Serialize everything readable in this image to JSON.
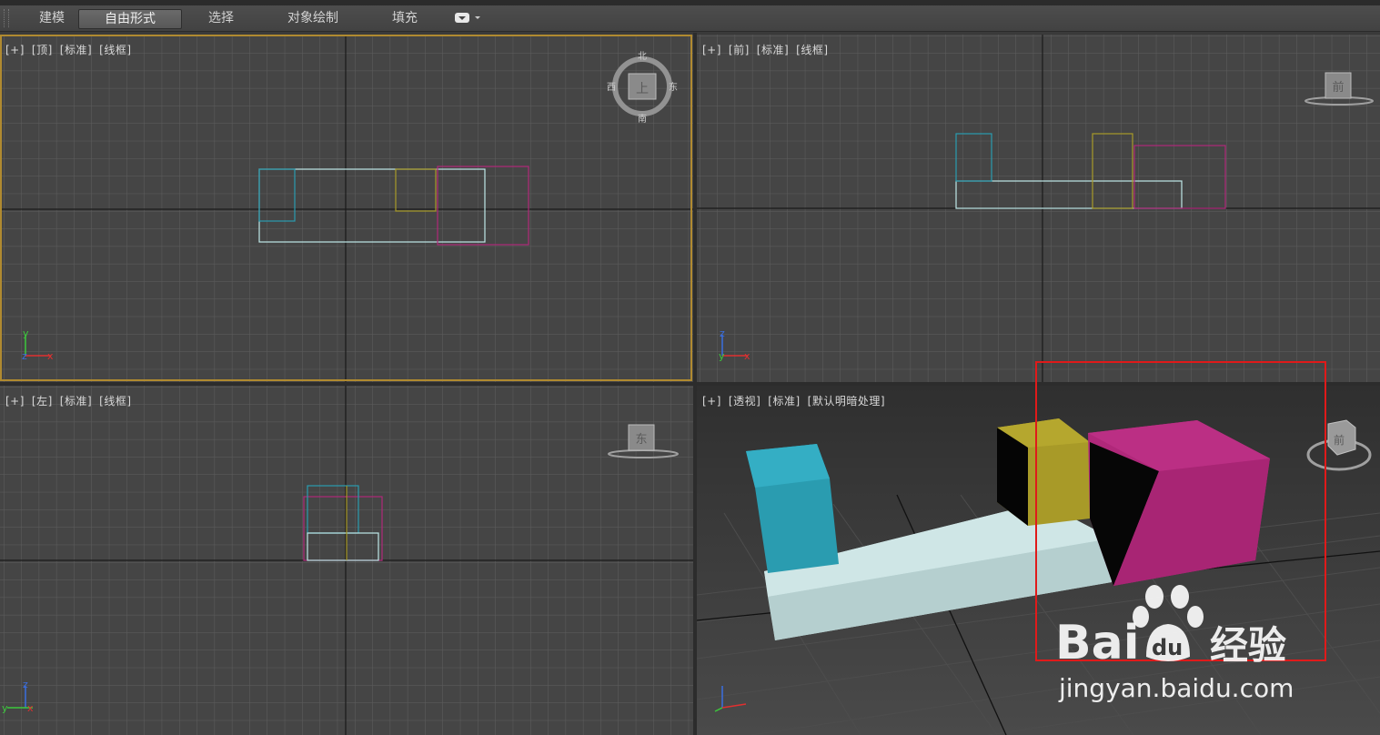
{
  "ribbon": {
    "tabs": [
      "建模",
      "自由形式",
      "选择",
      "对象绘制",
      "填充"
    ],
    "active_tab": "自由形式"
  },
  "viewports": {
    "top": {
      "plus": "[+]",
      "view": "[顶]",
      "mode": "[标准]",
      "shading": "[线框]",
      "compass": {
        "n": "北",
        "s": "南",
        "e": "东",
        "w": "西",
        "center": "上"
      }
    },
    "front": {
      "plus": "[+]",
      "view": "[前]",
      "mode": "[标准]",
      "shading": "[线框]",
      "cube_label": "前"
    },
    "left": {
      "plus": "[+]",
      "view": "[左]",
      "mode": "[标准]",
      "shading": "[线框]",
      "cube_label": "东"
    },
    "perspective": {
      "plus": "[+]",
      "view": "[透视]",
      "mode": "[标准]",
      "shading": "[默认明暗处理]",
      "cube_label": "前"
    }
  },
  "axes": {
    "top": {
      "up": "y",
      "right": "x",
      "origin": "z"
    },
    "front": {
      "up": "z",
      "right": "x",
      "origin": "y"
    },
    "left": {
      "up": "z",
      "right": "x",
      "origin": "y"
    }
  },
  "colors": {
    "cyan_box": "#2a9cb0",
    "yellow_box": "#a89a28",
    "magenta_box": "#b0287a",
    "base_box": "#bfdcdc",
    "active_border": "#b08a30",
    "annotation": "#e01a1a"
  },
  "watermark": {
    "brand_a": "Bai",
    "brand_b": "du",
    "brand_c": "经验",
    "url": "jingyan.baidu.com"
  }
}
